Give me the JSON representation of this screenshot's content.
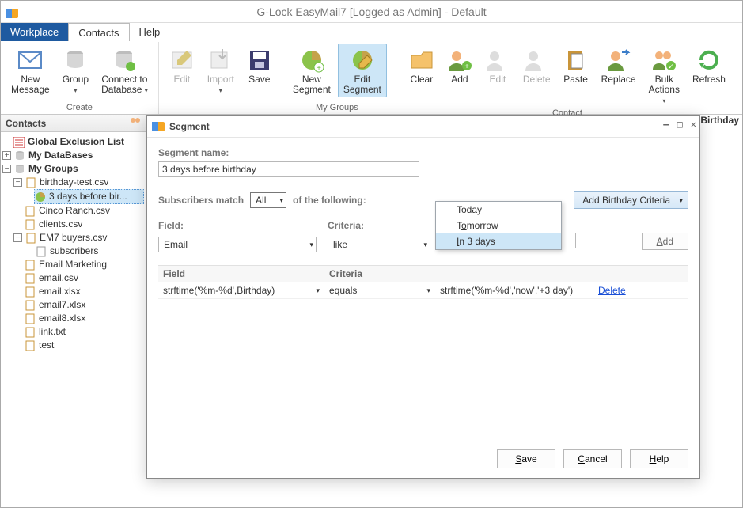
{
  "window": {
    "title": "G-Lock EasyMail7 [Logged as Admin] - Default"
  },
  "tabs": {
    "workplace": "Workplace",
    "contacts": "Contacts",
    "help": "Help"
  },
  "ribbon": {
    "groups": {
      "create": {
        "label": "Create",
        "new_message": "New\nMessage",
        "group": "Group",
        "connect_db": "Connect to\nDatabase"
      },
      "main": {
        "edit": "Edit",
        "import": "Import",
        "save": "Save"
      },
      "mygroups": {
        "label": "My Groups",
        "new_segment": "New\nSegment",
        "edit_segment": "Edit\nSegment"
      },
      "contact": {
        "label": "Contact",
        "clear": "Clear",
        "add": "Add",
        "edit": "Edit",
        "delete": "Delete",
        "paste": "Paste",
        "replace": "Replace",
        "bulk": "Bulk\nActions",
        "refresh": "Refresh"
      }
    }
  },
  "sidebar": {
    "title": "Contacts",
    "global_exclusion": "Global Exclusion List",
    "my_databases": "My DataBases",
    "my_groups": "My Groups",
    "items": [
      {
        "label": "birthday-test.csv",
        "children": [
          {
            "label": "3 days before bir..."
          }
        ]
      },
      {
        "label": "Cinco Ranch.csv"
      },
      {
        "label": "clients.csv"
      },
      {
        "label": "EM7 buyers.csv",
        "children": [
          {
            "label": "subscribers"
          }
        ]
      },
      {
        "label": "Email Marketing"
      },
      {
        "label": "email.csv"
      },
      {
        "label": "email.xlsx"
      },
      {
        "label": "email7.xlsx"
      },
      {
        "label": "email8.xlsx"
      },
      {
        "label": "link.txt"
      },
      {
        "label": "test"
      }
    ]
  },
  "right_header": "Birthday",
  "segment": {
    "window_title": "Segment",
    "name_label": "Segment name:",
    "name_value": "3 days before birthday",
    "match_label_left": "Subscribers match",
    "match_value": "All",
    "match_label_right": "of the following:",
    "add_criteria_btn": "Add Birthday Criteria",
    "menu": {
      "today": "Today",
      "tomorrow": "Tomorrow",
      "in3": "In 3 days"
    },
    "field_label": "Field:",
    "criteria_label": "Criteria:",
    "field_value": "Email",
    "criteria_value": "like",
    "input_value": "",
    "add_btn": "Add",
    "grid": {
      "head_field": "Field",
      "head_criteria": "Criteria",
      "rows": [
        {
          "field": "strftime('%m-%d',Birthday)",
          "criteria": "equals",
          "value": "strftime('%m-%d','now','+3 day')",
          "action": "Delete"
        }
      ]
    },
    "save": "Save",
    "cancel": "Cancel",
    "help": "Help"
  }
}
